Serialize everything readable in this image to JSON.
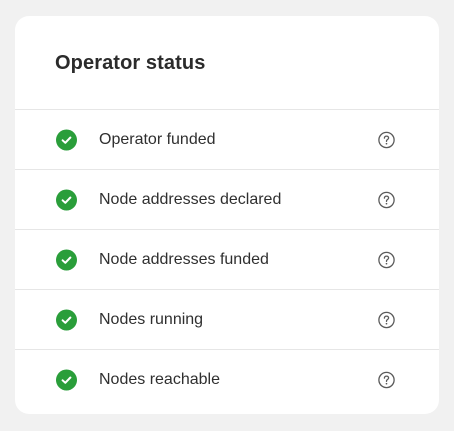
{
  "card": {
    "title": "Operator status"
  },
  "colors": {
    "success": "#2a9e3a",
    "help_icon": "#5a5a5a",
    "divider": "#e6e6e6",
    "background": "#f1f1f1",
    "card": "#ffffff"
  },
  "statuses": [
    {
      "label": "Operator funded",
      "state": "complete",
      "icon": "check-circle-icon",
      "help_icon": "question-circle-icon"
    },
    {
      "label": "Node addresses declared",
      "state": "complete",
      "icon": "check-circle-icon",
      "help_icon": "question-circle-icon"
    },
    {
      "label": "Node addresses funded",
      "state": "complete",
      "icon": "check-circle-icon",
      "help_icon": "question-circle-icon"
    },
    {
      "label": "Nodes running",
      "state": "complete",
      "icon": "check-circle-icon",
      "help_icon": "question-circle-icon"
    },
    {
      "label": "Nodes reachable",
      "state": "complete",
      "icon": "check-circle-icon",
      "help_icon": "question-circle-icon"
    }
  ]
}
